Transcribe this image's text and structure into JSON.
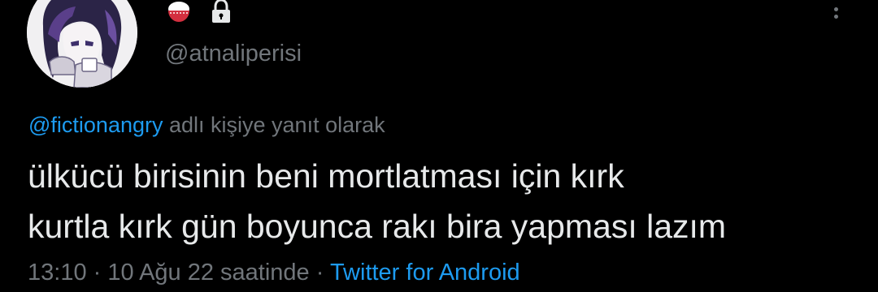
{
  "author": {
    "handle": "@atnaliperisi"
  },
  "reply": {
    "mention": "@fictionangry",
    "suffix": " adlı kişiye yanıt olarak"
  },
  "tweet": {
    "lines": [
      "ülkücü birisinin beni mortlatması için kırk",
      "kurtla kırk gün boyunca rakı bira yapması lazım"
    ]
  },
  "meta": {
    "time": "13:10",
    "separator": " · ",
    "date": "10 Ağu 22 saatinde",
    "source": "Twitter for Android"
  },
  "icons": {
    "name_emoji": "rice-bowl-icon",
    "protected": "lock-icon",
    "more": "more-options-icon"
  },
  "colors": {
    "background": "#000000",
    "primary_text": "#e7e9ea",
    "secondary_text": "#71767b",
    "link": "#1d9bf0"
  }
}
